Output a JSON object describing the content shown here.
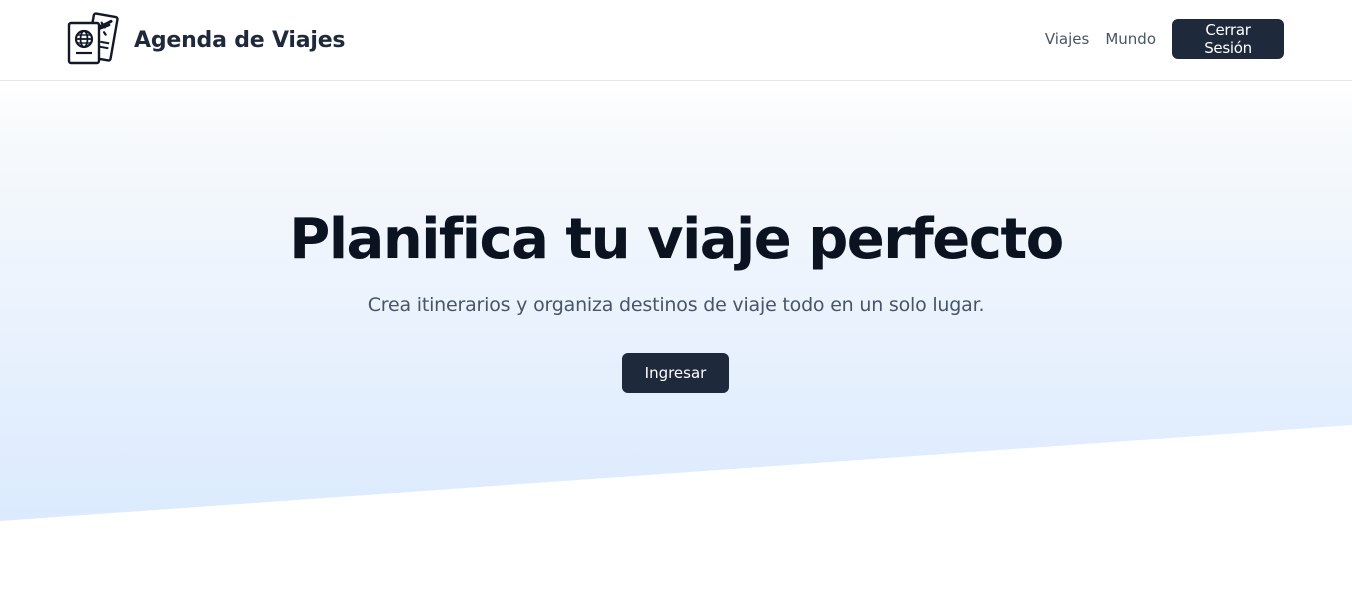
{
  "header": {
    "brand_title": "Agenda de Viajes",
    "logo_icon": "passport-plane-icon",
    "nav": {
      "trips_label": "Viajes",
      "world_label": "Mundo",
      "logout_label": "Cerrar Sesión"
    }
  },
  "hero": {
    "title": "Planifica tu viaje perfecto",
    "subtitle": "Crea itinerarios y organiza destinos de viaje todo en un solo lugar.",
    "cta_label": "Ingresar"
  },
  "colors": {
    "primary_button": "#1e293b",
    "hero_gradient_top": "#f8fafc",
    "hero_gradient_bottom": "#dbeafe",
    "muted_text": "#475569"
  }
}
